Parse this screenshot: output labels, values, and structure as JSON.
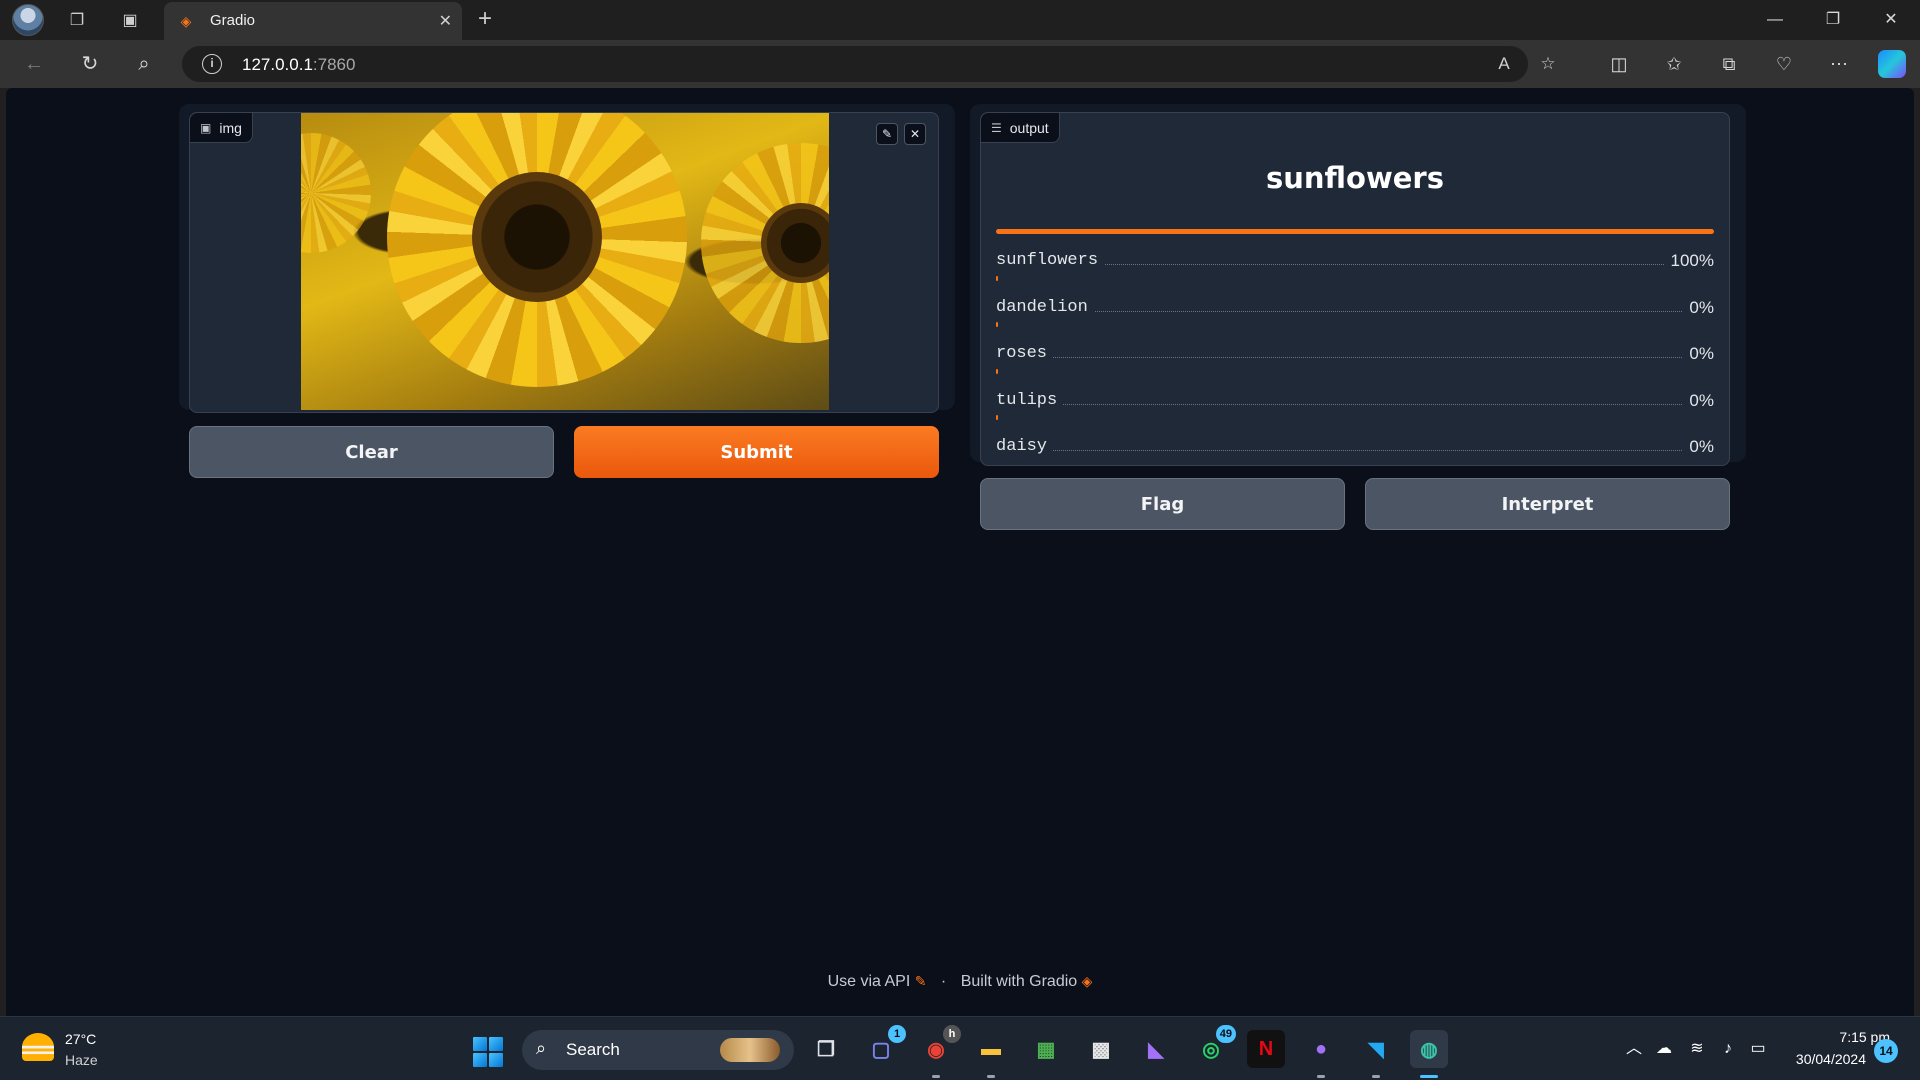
{
  "browser": {
    "tab_title": "Gradio",
    "url_host": "127.0.0.1",
    "url_port": ":7860"
  },
  "app": {
    "input_label": "img",
    "output_label": "output",
    "predicted_label": "sunflowers",
    "confidences": [
      {
        "label": "sunflowers",
        "value": "100%",
        "fraction": 1.0
      },
      {
        "label": "dandelion",
        "value": "0%",
        "fraction": 0.0
      },
      {
        "label": "roses",
        "value": "0%",
        "fraction": 0.0
      },
      {
        "label": "tulips",
        "value": "0%",
        "fraction": 0.0
      },
      {
        "label": "daisy",
        "value": "0%",
        "fraction": 0.0
      }
    ],
    "buttons": {
      "clear": "Clear",
      "submit": "Submit",
      "flag": "Flag",
      "interpret": "Interpret"
    },
    "footer": {
      "api": "Use via API",
      "separator": "·",
      "built": "Built with Gradio"
    },
    "accent_color": "#f97316"
  },
  "taskbar": {
    "weather_temp": "27°C",
    "weather_desc": "Haze",
    "search_label": "Search",
    "badges": {
      "teams": "1",
      "chrome": "h",
      "whatsapp": "49"
    },
    "clock_time": "7:15 pm",
    "clock_date": "30/04/2024",
    "notification_count": "14"
  }
}
